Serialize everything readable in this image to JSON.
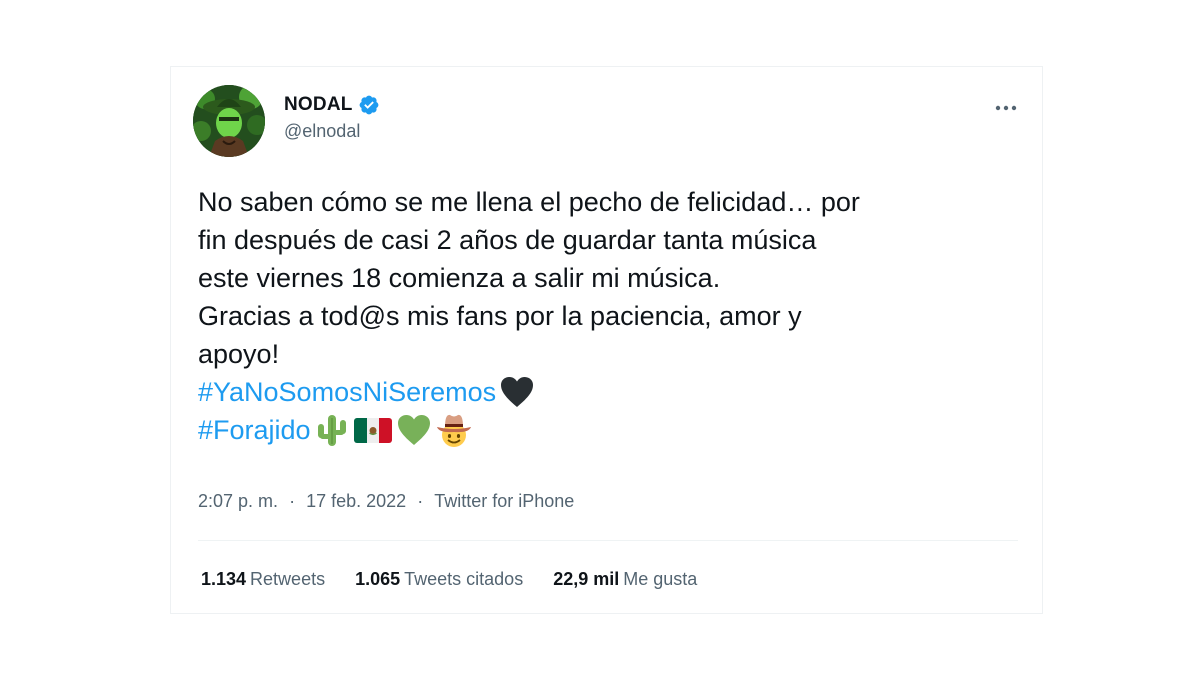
{
  "author": {
    "name": "NODAL",
    "handle": "@elnodal",
    "verified": true
  },
  "tweet": {
    "lines": [
      "No saben cómo se me llena el pecho de felicidad… por",
      "fin después de casi 2 años de guardar tanta música",
      "este viernes 18 comienza a salir mi música.",
      "Gracias a tod@s mis fans por la paciencia, amor y",
      "apoyo!"
    ],
    "hashtags": [
      "#YaNoSomosNiSeremos",
      "#Forajido"
    ],
    "emojis": [
      "black-heart",
      "cactus",
      "mexico-flag",
      "green-heart",
      "cowboy-face"
    ]
  },
  "meta": {
    "time": "2:07 p. m.",
    "separator": "·",
    "date": "17 feb. 2022",
    "source": "Twitter for iPhone"
  },
  "stats": {
    "retweets_count": "1.134",
    "retweets_label": "Retweets",
    "quotes_count": "1.065",
    "quotes_label": "Tweets citados",
    "likes_count": "22,9 mil",
    "likes_label": "Me gusta"
  },
  "colors": {
    "link": "#1d9bf0",
    "text": "#0f1419",
    "secondary": "#536471",
    "verified": "#1d9bf0"
  }
}
